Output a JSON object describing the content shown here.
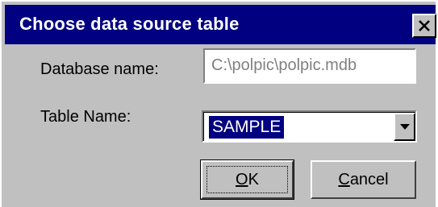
{
  "window": {
    "title": "Choose data source table",
    "close_icon": "close-icon"
  },
  "form": {
    "database_label": "Database name:",
    "database_value": "C:\\polpic\\polpic.mdb",
    "table_label": "Table Name:",
    "table_value": "SAMPLE",
    "dropdown_icon": "chevron-down-icon"
  },
  "buttons": {
    "ok_mnemonic": "O",
    "ok_rest": "K",
    "cancel_mnemonic": "C",
    "cancel_rest": "ancel"
  },
  "colors": {
    "titlebar": "#000080",
    "face": "#c0c0c0",
    "selection": "#000080",
    "disabled_text": "#808080"
  }
}
